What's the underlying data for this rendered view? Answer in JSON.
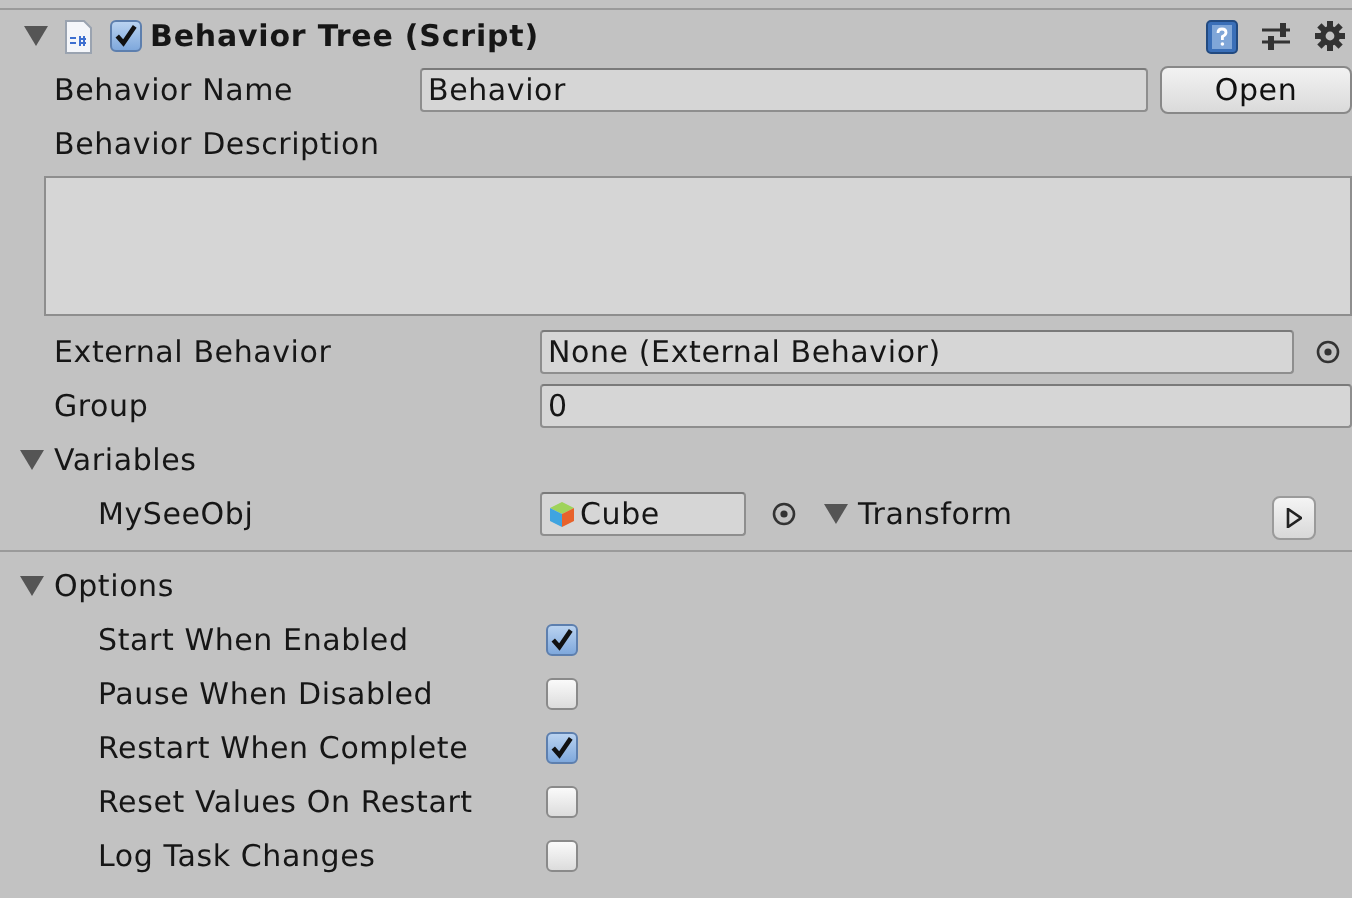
{
  "component": {
    "title": "Behavior Tree (Script)",
    "expanded": true,
    "enabled": true,
    "open_button": "Open"
  },
  "behavior_name": {
    "label": "Behavior Name",
    "value": "Behavior"
  },
  "behavior_description": {
    "label": "Behavior Description"
  },
  "external_behavior": {
    "label": "External Behavior",
    "value": "None (External Behavior)"
  },
  "group": {
    "label": "Group",
    "value": "0"
  },
  "variables": {
    "label": "Variables",
    "expanded": true,
    "items": [
      {
        "name": "MySeeObj",
        "value": "Cube",
        "type_label": "Transform",
        "type_expanded": true
      }
    ]
  },
  "options": {
    "label": "Options",
    "expanded": true,
    "items": [
      {
        "label": "Start When Enabled",
        "checked": true
      },
      {
        "label": "Pause When Disabled",
        "checked": false
      },
      {
        "label": "Restart When Complete",
        "checked": true
      },
      {
        "label": "Reset Values On Restart",
        "checked": false
      },
      {
        "label": "Log Task Changes",
        "checked": false
      }
    ]
  }
}
